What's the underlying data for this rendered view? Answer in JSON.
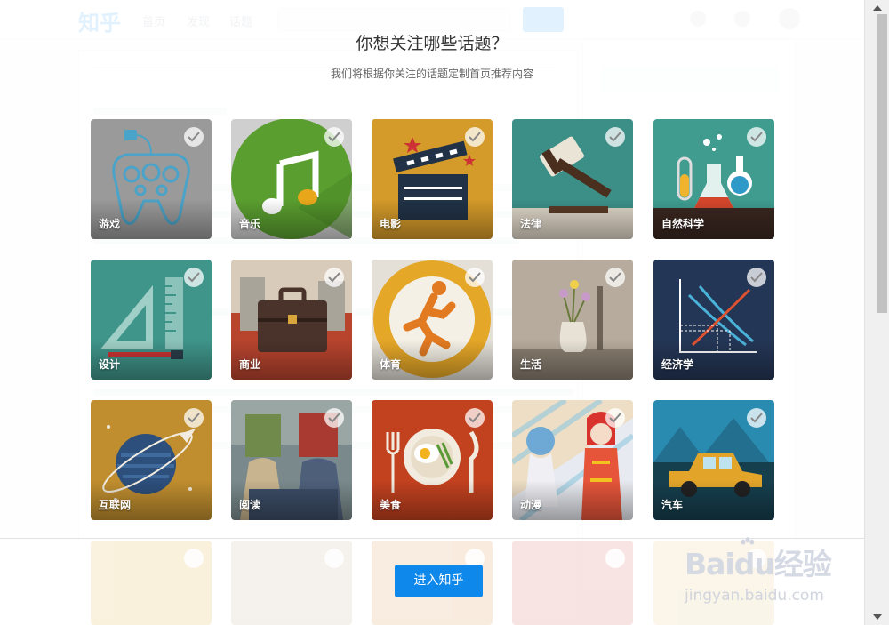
{
  "background_page": {
    "logo": "知乎",
    "nav": [
      "首页",
      "发现",
      "话题"
    ],
    "search_placeholder": "搜索你感兴趣的内容...",
    "ask_label": "提问"
  },
  "modal": {
    "title": "你想关注哪些话题？",
    "subtitle": "我们将根据你关注的话题定制首页推荐内容",
    "enter_button": "进入知乎"
  },
  "topics": [
    {
      "label": "游戏",
      "icon": "gamepad-icon",
      "selected": true
    },
    {
      "label": "音乐",
      "icon": "music-note-icon",
      "selected": true
    },
    {
      "label": "电影",
      "icon": "clapperboard-icon",
      "selected": true
    },
    {
      "label": "法律",
      "icon": "gavel-icon",
      "selected": true
    },
    {
      "label": "自然科学",
      "icon": "test-tubes-icon",
      "selected": true
    },
    {
      "label": "设计",
      "icon": "ruler-triangle-icon",
      "selected": true
    },
    {
      "label": "商业",
      "icon": "briefcase-icon",
      "selected": true
    },
    {
      "label": "体育",
      "icon": "runner-icon",
      "selected": true
    },
    {
      "label": "生活",
      "icon": "flower-vase-icon",
      "selected": true
    },
    {
      "label": "经济学",
      "icon": "supply-demand-chart-icon",
      "selected": true
    },
    {
      "label": "互联网",
      "icon": "planet-icon",
      "selected": true
    },
    {
      "label": "阅读",
      "icon": "reading-people-icon",
      "selected": true
    },
    {
      "label": "美食",
      "icon": "plate-cutlery-icon",
      "selected": true
    },
    {
      "label": "动漫",
      "icon": "anime-characters-icon",
      "selected": true
    },
    {
      "label": "汽车",
      "icon": "car-icon",
      "selected": true
    }
  ],
  "watermark": {
    "text": "Baidu经验",
    "url": "jingyan.baidu.com"
  },
  "colors": {
    "accent": "#0f88eb"
  }
}
